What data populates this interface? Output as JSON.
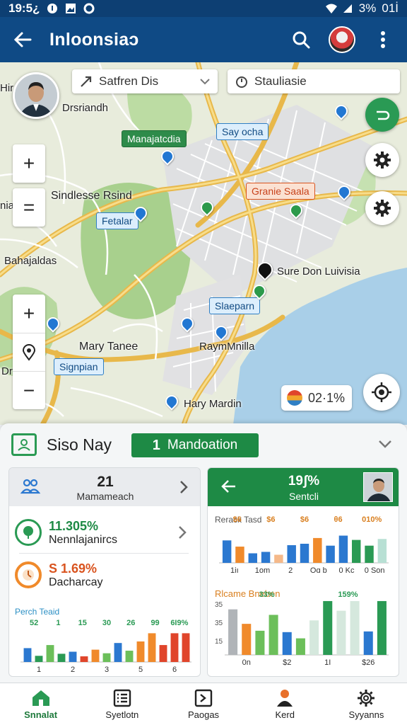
{
  "status_bar": {
    "time": "19:5¿",
    "battery": "3%",
    "signal_label": "01İ"
  },
  "app_bar": {
    "title": "Inloonsiaɔ"
  },
  "map": {
    "search_primary": "Satfren Dis",
    "search_secondary": "Stauliasie",
    "labels": {
      "drsriandh": "Drsriandh",
      "sindlesse": "Sindlesse Rsind",
      "bahajaldas": "Bahajaldas",
      "sure_don": "Sure Don Luivisia",
      "mary_tanee": "Mary Tanee",
      "raymnilla": "RaymMnilla",
      "harry_mardin": "Hary Mardin",
      "edge_hir": "Hir",
      "edge_nia": "nia",
      "edge_dr": "Dr"
    },
    "tags": {
      "manajatcdia": "Manajatcdia",
      "say_ocha": "Say ocha",
      "game_saala": "Granie Saala",
      "fetalar": "Fetalar",
      "slaapran": "Slaeparn",
      "signpian": "Signpian"
    },
    "weather_value": "02·1%"
  },
  "panel": {
    "title": "Siso Nay",
    "mode_number": "1",
    "mode_label": "Mandoation",
    "left_card": {
      "head_value": "21",
      "head_label": "Mamameach",
      "stat1_value": "11.305%",
      "stat1_label": "Nennlajanircs",
      "stat2_value": "S 1.69%",
      "stat2_label": "Dacharcay",
      "chart_title": "Perch Teaid"
    },
    "right_card": {
      "head_value": "19ʃ%",
      "head_label": "Sentcli",
      "chart1_title": "Rerack Tasd",
      "chart2_title": "Rlcame Bneben"
    }
  },
  "bottom_nav": [
    {
      "label": "Snnalat",
      "icon": "home-icon"
    },
    {
      "label": "Syetlotn",
      "icon": "list-icon"
    },
    {
      "label": "Paogas",
      "icon": "pages-icon"
    },
    {
      "label": "Kerd",
      "icon": "person-icon"
    },
    {
      "label": "Syyanns",
      "icon": "settings-icon"
    }
  ],
  "chart_data": [
    {
      "type": "bar",
      "title": "Perch Teaid",
      "categories": [
        "1",
        "2",
        "3",
        "5",
        "6"
      ],
      "value_labels": [
        "52",
        "1",
        "15",
        "30",
        "26",
        "99",
        "6I9%"
      ],
      "values": [
        27,
        12,
        33,
        16,
        20,
        11,
        24,
        17,
        37,
        22,
        40,
        56,
        33,
        56,
        56
      ],
      "colors": [
        "#2b78d0",
        "#2a9a54",
        "#6cbf5a",
        "#2a9a54",
        "#2b78d0",
        "#e0452b",
        "#f08a2b",
        "#6cbf5a",
        "#2b78d0",
        "#6cbf5a",
        "#f08a2b",
        "#f08a2b",
        "#e0452b",
        "#e0452b",
        "#e0452b"
      ]
    },
    {
      "type": "bar",
      "title": "Rerack Tasd",
      "categories": [
        "1iı",
        "1οm",
        "2",
        "Oɑ b",
        "0 Kc",
        "0 Sοn"
      ],
      "value_labels": [
        "$6",
        "$6",
        "$6",
        "θ6",
        "010%"
      ],
      "values": [
        47,
        34,
        20,
        23,
        17,
        37,
        40,
        52,
        36,
        57,
        48,
        36,
        50
      ],
      "colors": [
        "#2b78d0",
        "#f08a2b",
        "#2b78d0",
        "#2b78d0",
        "#f5b98a",
        "#2b78d0",
        "#2b78d0",
        "#f08a2b",
        "#2b78d0",
        "#2b78d0",
        "#2a9a54",
        "#2a9a54",
        "#b8e0d4"
      ]
    },
    {
      "type": "bar",
      "title": "Rlcame Bneben",
      "categories": [
        "0n",
        "$2",
        "1I",
        "$26"
      ],
      "value_labels": [
        "33%",
        "159%"
      ],
      "y_ticks": [
        "35",
        "35",
        "15"
      ],
      "values": [
        66,
        45,
        35,
        58,
        33,
        24,
        50,
        78,
        64,
        78,
        34,
        78
      ],
      "colors": [
        "#b0b4b8",
        "#f08a2b",
        "#6cbf5a",
        "#6cbf5a",
        "#2b78d0",
        "#6cbf5a",
        "#d5e8dd",
        "#2a9a54",
        "#d5e8dd",
        "#d5e8dd",
        "#2b78d0",
        "#2a9a54"
      ]
    }
  ]
}
